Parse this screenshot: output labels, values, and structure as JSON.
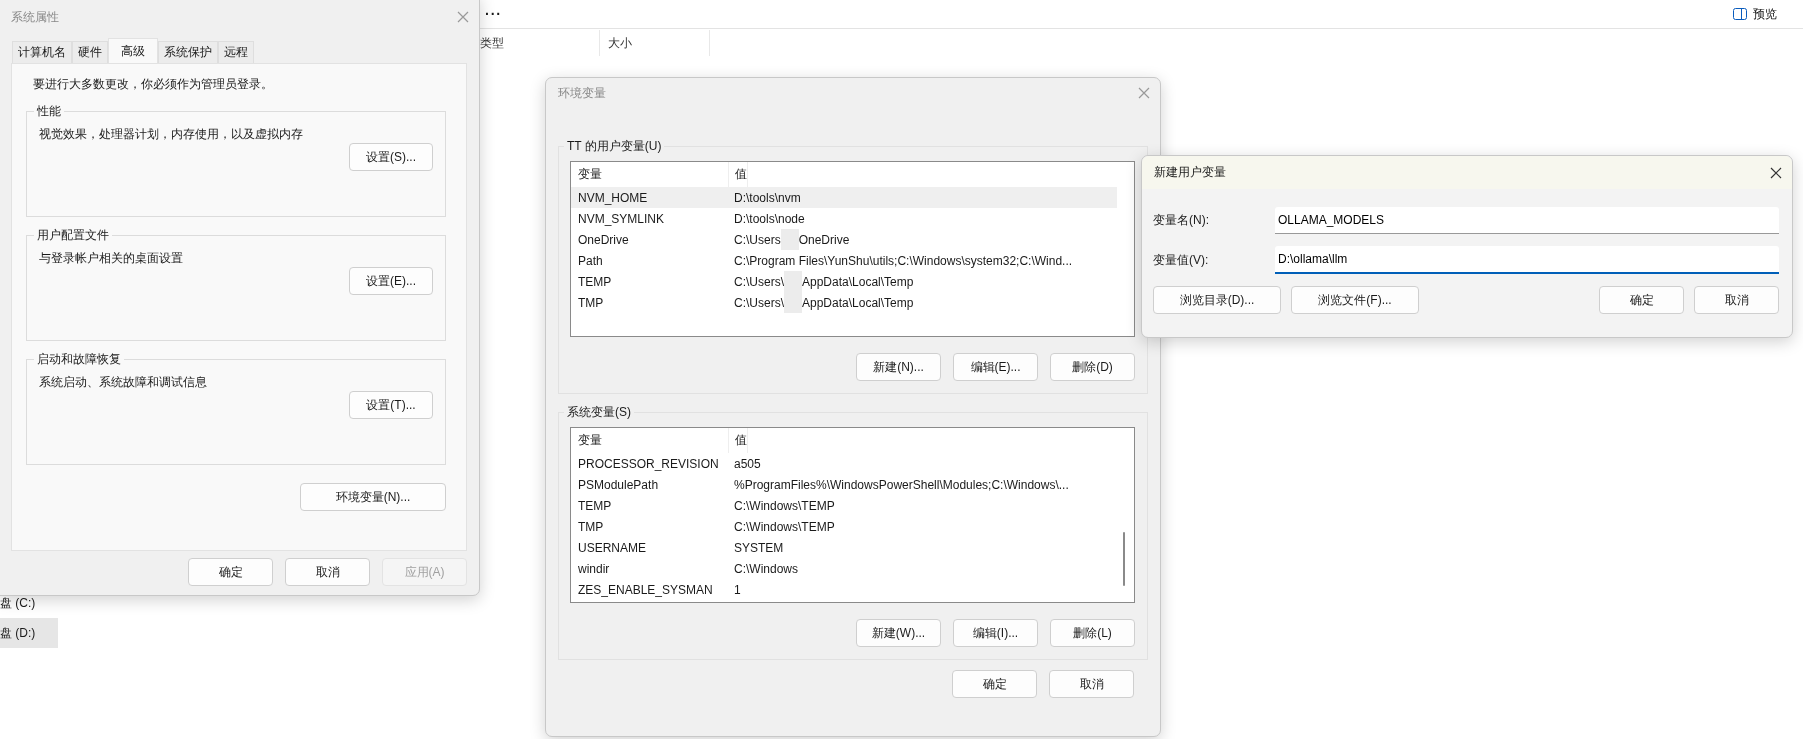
{
  "explorer": {
    "more_button": "···",
    "preview_button": "预览",
    "columns": [
      "类型",
      "大小"
    ],
    "drives": [
      {
        "label": "盘 (C:)",
        "selected": false
      },
      {
        "label": "盘 (D:)",
        "selected": true
      }
    ]
  },
  "system_properties": {
    "title": "系统属性",
    "tabs": [
      {
        "label": "计算机名",
        "selected": false
      },
      {
        "label": "硬件",
        "selected": false
      },
      {
        "label": "高级",
        "selected": true
      },
      {
        "label": "系统保护",
        "selected": false
      },
      {
        "label": "远程",
        "selected": false
      }
    ],
    "notice": "要进行大多数更改，你必须作为管理员登录。",
    "groups": [
      {
        "title": "性能",
        "description": "视觉效果，处理器计划，内存使用，以及虚拟内存",
        "button": "设置(S)..."
      },
      {
        "title": "用户配置文件",
        "description": "与登录帐户相关的桌面设置",
        "button": "设置(E)..."
      },
      {
        "title": "启动和故障恢复",
        "description": "系统启动、系统故障和调试信息",
        "button": "设置(T)..."
      }
    ],
    "env_button": "环境变量(N)...",
    "buttons": [
      {
        "label": "确定",
        "disabled": false
      },
      {
        "label": "取消",
        "disabled": false
      },
      {
        "label": "应用(A)",
        "disabled": true
      }
    ]
  },
  "environment_variables": {
    "title": "环境变量",
    "sections": [
      {
        "title": "TT 的用户变量(U)",
        "columns": [
          "变量",
          "值"
        ],
        "scrollbar": false,
        "rows": [
          {
            "name": "NVM_HOME",
            "value": [
              "D:\\tools\\nvm"
            ],
            "selected": true
          },
          {
            "name": "NVM_SYMLINK",
            "value": [
              "D:\\tools\\node"
            ],
            "selected": false
          },
          {
            "name": "OneDrive",
            "value": [
              "C:\\Users",
              "OneDrive"
            ],
            "selected": false
          },
          {
            "name": "Path",
            "value": [
              "C:\\Program Files\\YunShu\\utils;C:\\Windows\\system32;C:\\Wind..."
            ],
            "selected": false
          },
          {
            "name": "TEMP",
            "value": [
              "C:\\Users\\",
              "AppData\\Local\\Temp"
            ],
            "selected": false
          },
          {
            "name": "TMP",
            "value": [
              "C:\\Users\\",
              "AppData\\Local\\Temp"
            ],
            "selected": false
          }
        ],
        "buttons": [
          "新建(N)...",
          "编辑(E)...",
          "删除(D)"
        ]
      },
      {
        "title": "系统变量(S)",
        "columns": [
          "变量",
          "值"
        ],
        "scrollbar": true,
        "rows": [
          {
            "name": "PROCESSOR_REVISION",
            "value": [
              "a505"
            ],
            "selected": false
          },
          {
            "name": "PSModulePath",
            "value": [
              "%ProgramFiles%\\WindowsPowerShell\\Modules;C:\\Windows\\..."
            ],
            "selected": false
          },
          {
            "name": "TEMP",
            "value": [
              "C:\\Windows\\TEMP"
            ],
            "selected": false
          },
          {
            "name": "TMP",
            "value": [
              "C:\\Windows\\TEMP"
            ],
            "selected": false
          },
          {
            "name": "USERNAME",
            "value": [
              "SYSTEM"
            ],
            "selected": false
          },
          {
            "name": "windir",
            "value": [
              "C:\\Windows"
            ],
            "selected": false
          },
          {
            "name": "ZES_ENABLE_SYSMAN",
            "value": [
              "1"
            ],
            "selected": false
          }
        ],
        "buttons": [
          "新建(W)...",
          "编辑(I)...",
          "删除(L)"
        ]
      }
    ],
    "buttons": [
      "确定",
      "取消"
    ]
  },
  "new_user_variable": {
    "title": "新建用户变量",
    "fields": [
      {
        "label": "变量名(N):",
        "value": "OLLAMA_MODELS",
        "focused": false
      },
      {
        "label": "变量值(V):",
        "value": "D:\\ollama\\llm",
        "focused": true
      }
    ],
    "left_buttons": [
      "浏览目录(D)...",
      "浏览文件(F)..."
    ],
    "right_buttons": [
      "确定",
      "取消"
    ]
  }
}
